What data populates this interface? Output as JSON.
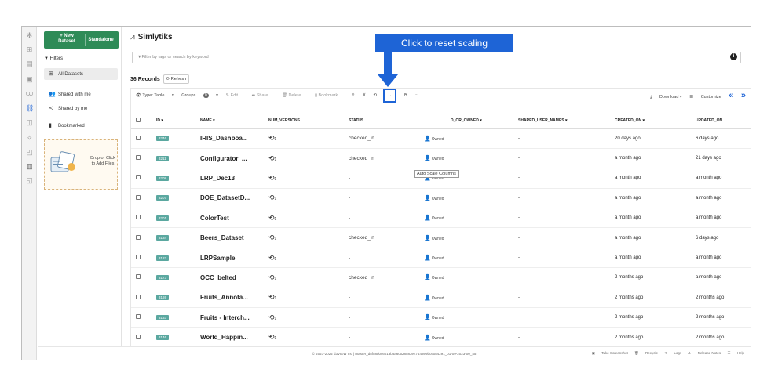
{
  "callout": {
    "text": "Click to reset scaling"
  },
  "rail": {
    "icons": [
      "dashboard-icon",
      "layers-icon",
      "table-icon",
      "import-icon",
      "chart-icon",
      "network-icon",
      "db-icon",
      "magic-icon",
      "doc-icon",
      "bars-icon",
      "file-icon"
    ]
  },
  "sidebar": {
    "new_label": "+ New\nDataset",
    "standalone_label": "Standalone",
    "filters_label": "Filters",
    "items": [
      {
        "label": "All Datasets"
      },
      {
        "label": "Shared with me"
      },
      {
        "label": "Shared by me"
      },
      {
        "label": "Bookmarked"
      }
    ],
    "drop_text": "Drop or Click\nto Add Files"
  },
  "header": {
    "title": "Simlytiks"
  },
  "search": {
    "placeholder": "Filter by tags or search by keyword"
  },
  "records": {
    "label": "36 Records",
    "refresh_label": "Refresh"
  },
  "toolbar": {
    "type_label": "Type: Table",
    "groups_label": "Groups",
    "groups_count": "0",
    "edit_label": "Edit",
    "share_label": "Share",
    "delete_label": "Delete",
    "bookmark_label": "Bookmark",
    "download_label": "Download",
    "customize_label": "Customize",
    "tooltip": "Auto Scale Columns"
  },
  "table": {
    "headers": {
      "id": "ID",
      "name": "NAME",
      "num_versions": "NUM_VERSIONS",
      "status": "STATUS",
      "shared_or_owned": "D_OR_OWNED",
      "shared_user_names": "SHARED_USER_NAMES",
      "created_on": "CREATED_ON",
      "updated_on": "UPDATED_ON"
    },
    "rows": [
      {
        "id": "3246",
        "name": "IRIS_Dashboa...",
        "ver": "1",
        "status": "checked_in",
        "owned": "Owned",
        "shared": "-",
        "created": "20 days ago",
        "updated": "6 days ago"
      },
      {
        "id": "3211",
        "name": "Configurator_...",
        "ver": "1",
        "status": "checked_in",
        "owned": "Owned",
        "shared": "-",
        "created": "a month ago",
        "updated": "21 days ago"
      },
      {
        "id": "3208",
        "name": "LRP_Dec13",
        "ver": "1",
        "status": "-",
        "owned": "Owned",
        "shared": "-",
        "created": "a month ago",
        "updated": "a month ago"
      },
      {
        "id": "3207",
        "name": "DOE_DatasetD...",
        "ver": "1",
        "status": "-",
        "owned": "Owned",
        "shared": "-",
        "created": "a month ago",
        "updated": "a month ago"
      },
      {
        "id": "3201",
        "name": "ColorTest",
        "ver": "1",
        "status": "-",
        "owned": "Owned",
        "shared": "-",
        "created": "a month ago",
        "updated": "a month ago"
      },
      {
        "id": "3184",
        "name": "Beers_Dataset",
        "ver": "1",
        "status": "checked_in",
        "owned": "Owned",
        "shared": "-",
        "created": "a month ago",
        "updated": "6 days ago"
      },
      {
        "id": "3182",
        "name": "LRPSample",
        "ver": "1",
        "status": "-",
        "owned": "Owned",
        "shared": "-",
        "created": "a month ago",
        "updated": "a month ago"
      },
      {
        "id": "3173",
        "name": "OCC_belted",
        "ver": "1",
        "status": "checked_in",
        "owned": "Owned",
        "shared": "-",
        "created": "2 months ago",
        "updated": "a month ago"
      },
      {
        "id": "3169",
        "name": "Fruits_Annota...",
        "ver": "1",
        "status": "-",
        "owned": "Owned",
        "shared": "-",
        "created": "2 months ago",
        "updated": "2 months ago"
      },
      {
        "id": "3153",
        "name": "Fruits - Interch...",
        "ver": "1",
        "status": "-",
        "owned": "Owned",
        "shared": "-",
        "created": "2 months ago",
        "updated": "2 months ago"
      },
      {
        "id": "3146",
        "name": "World_Happin...",
        "ver": "1",
        "status": "-",
        "owned": "Owned",
        "shared": "-",
        "created": "2 months ago",
        "updated": "2 months ago"
      }
    ]
  },
  "footer": {
    "copyright": "© 2021-2022 d3VIEW Inc | master_d8f58d0c6013b6a6c528583e47448e9bc6084291_01-09-2023-00_45",
    "screenshot_label": "Take Screenshot",
    "recycle_label": "Recycle",
    "logs_label": "Logs",
    "release_label": "Release Notes",
    "help_label": "Help"
  },
  "colors": {
    "accent": "#1e64d6",
    "new_button": "#2e8b57",
    "id_badge": "#5ba8a0"
  }
}
